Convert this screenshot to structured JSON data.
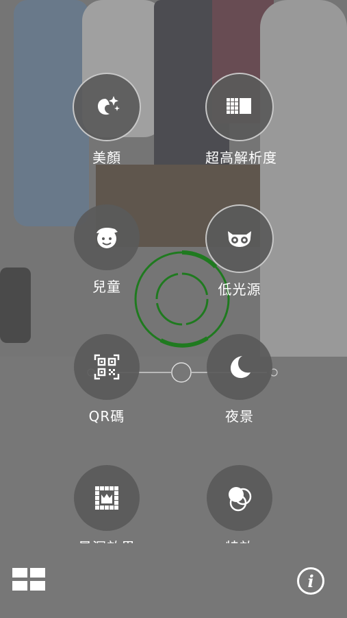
{
  "modes": [
    {
      "id": "beauty",
      "label": "美顏",
      "icon": "beauty-sparkle-icon",
      "ringed": true
    },
    {
      "id": "super-resolution",
      "label": "超高解析度",
      "icon": "super-resolution-grid-icon",
      "ringed": true
    },
    {
      "id": "children",
      "label": "兒童",
      "icon": "child-face-icon",
      "ringed": false
    },
    {
      "id": "low-light",
      "label": "低光源",
      "icon": "owl-eyes-icon",
      "ringed": true
    },
    {
      "id": "qr-code",
      "label": "QR碼",
      "icon": "qr-code-icon",
      "ringed": false
    },
    {
      "id": "night",
      "label": "夜景",
      "icon": "moon-icon",
      "ringed": false
    },
    {
      "id": "depth-of-field",
      "label": "景深效果",
      "icon": "depth-frame-icon",
      "ringed": false
    },
    {
      "id": "effects",
      "label": "特效",
      "icon": "overlapping-circles-icon",
      "ringed": false
    }
  ],
  "bottom_bar": {
    "grid_icon": "mode-grid-icon",
    "info_icon": "info-icon",
    "info_glyph": "i"
  },
  "colors": {
    "focus_ring": "#1f7a1f",
    "label": "#ffffff",
    "mode_circle": "#5a5a5a"
  }
}
